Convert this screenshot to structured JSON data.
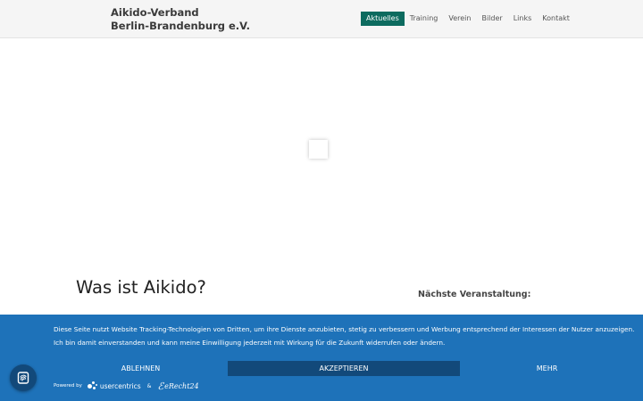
{
  "header": {
    "title_line1": "Aikido-Verband",
    "title_line2": "Berlin-Brandenburg e.V.",
    "nav": [
      {
        "label": "Aktuelles",
        "active": true
      },
      {
        "label": "Training"
      },
      {
        "label": "Verein"
      },
      {
        "label": "Bilder"
      },
      {
        "label": "Links"
      },
      {
        "label": "Kontakt"
      }
    ]
  },
  "main": {
    "heading": "Was ist Aikido?",
    "sidebar_heading": "Nächste Veranstaltung:"
  },
  "consent": {
    "text": "Diese Seite nutzt Website Tracking-Technologien von Dritten, um ihre Dienste anzubieten, stetig zu verbessern und Werbung entsprechend der Interessen der Nutzer anzuzeigen. Ich bin damit einverstanden und kann meine Einwilligung jederzeit mit Wirkung für die Zukunft widerrufen oder ändern.",
    "decline_label": "ABLEHNEN",
    "accept_label": "AKZEPTIEREN",
    "more_label": "MEHR",
    "powered_by": "Powered by",
    "provider1": "usercentrics",
    "amp": "&",
    "provider2": "eRecht24",
    "background_color": "#1e72b9",
    "accept_color": "#12497a"
  },
  "icons": {
    "fab": "fingerprint-icon",
    "loader": "loading-spinner-icon"
  },
  "colors": {
    "nav_active": "#0d6b5f"
  }
}
